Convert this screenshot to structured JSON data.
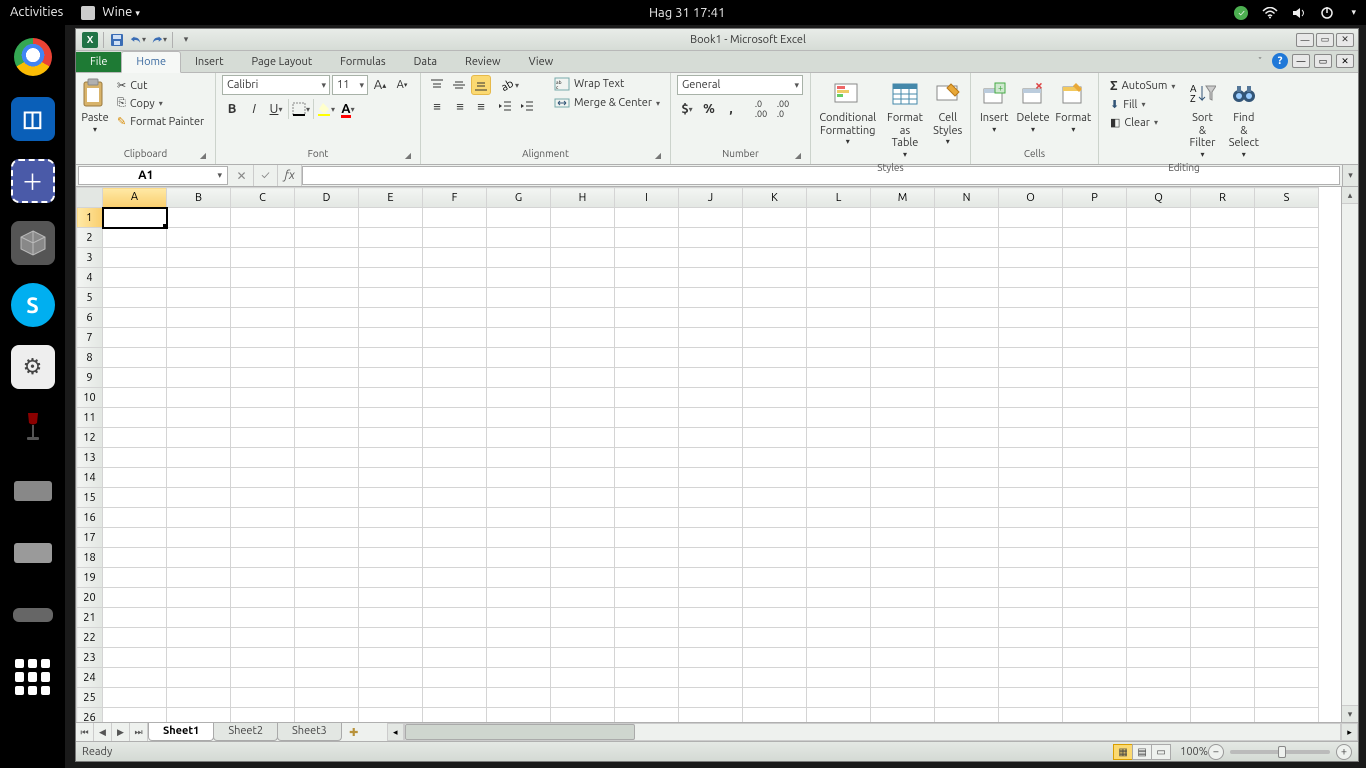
{
  "topbar": {
    "activities": "Activities",
    "app": "Wine",
    "clock": "Hag 31  17:41"
  },
  "title": "Book1  -  Microsoft Excel",
  "qat": {
    "save": "save-icon",
    "undo": "undo-icon",
    "redo": "redo-icon"
  },
  "tabs": [
    "File",
    "Home",
    "Insert",
    "Page Layout",
    "Formulas",
    "Data",
    "Review",
    "View"
  ],
  "active_tab": "Home",
  "ribbon": {
    "clipboard": {
      "label": "Clipboard",
      "paste": "Paste",
      "cut": "Cut",
      "copy": "Copy",
      "painter": "Format Painter"
    },
    "font": {
      "label": "Font",
      "name": "Calibri",
      "size": "11"
    },
    "alignment": {
      "label": "Alignment",
      "wrap": "Wrap Text",
      "merge": "Merge & Center"
    },
    "number": {
      "label": "Number",
      "format": "General"
    },
    "styles": {
      "label": "Styles",
      "cond": "Conditional Formatting",
      "table": "Format as Table",
      "cell": "Cell Styles"
    },
    "cells": {
      "label": "Cells",
      "insert": "Insert",
      "delete": "Delete",
      "format": "Format"
    },
    "editing": {
      "label": "Editing",
      "sum": "AutoSum",
      "fill": "Fill",
      "clear": "Clear",
      "sort": "Sort & Filter",
      "find": "Find & Select"
    }
  },
  "namebox": "A1",
  "formula": "",
  "columns": [
    "A",
    "B",
    "C",
    "D",
    "E",
    "F",
    "G",
    "H",
    "I",
    "J",
    "K",
    "L",
    "M",
    "N",
    "O",
    "P",
    "Q",
    "R",
    "S"
  ],
  "rows": 26,
  "active_cell": {
    "row": 1,
    "col": "A"
  },
  "sheets": [
    "Sheet1",
    "Sheet2",
    "Sheet3"
  ],
  "active_sheet": "Sheet1",
  "status": "Ready",
  "zoom": "100%"
}
